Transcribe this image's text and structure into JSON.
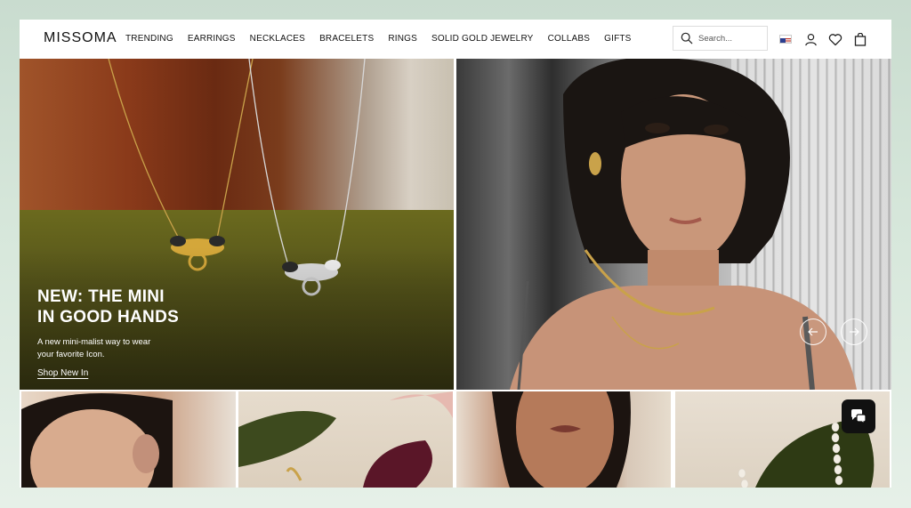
{
  "brand": {
    "logo_text": "MISSOMA"
  },
  "nav": {
    "items": [
      {
        "label": "TRENDING"
      },
      {
        "label": "EARRINGS"
      },
      {
        "label": "NECKLACES"
      },
      {
        "label": "BRACELETS"
      },
      {
        "label": "RINGS"
      },
      {
        "label": "SOLID GOLD JEWELRY"
      },
      {
        "label": "COLLABS"
      },
      {
        "label": "GIFTS"
      }
    ]
  },
  "search": {
    "placeholder": "Search..."
  },
  "header_icons": [
    "us-flag-icon",
    "account-icon",
    "wishlist-heart-icon",
    "bag-icon"
  ],
  "hero": {
    "title_line1": "NEW: THE MINI",
    "title_line2": "IN GOOD HANDS",
    "subtitle_line1": "A new mini-malist way to wear",
    "subtitle_line2": "your favorite Icon.",
    "cta_label": "Shop New In"
  },
  "carousel": {
    "prev_icon": "arrow-left-icon",
    "next_icon": "arrow-right-icon"
  },
  "chat": {
    "icon": "chat-bubbles-icon"
  },
  "colors": {
    "background": "#d8e8dc",
    "text": "#111111",
    "white": "#ffffff"
  }
}
